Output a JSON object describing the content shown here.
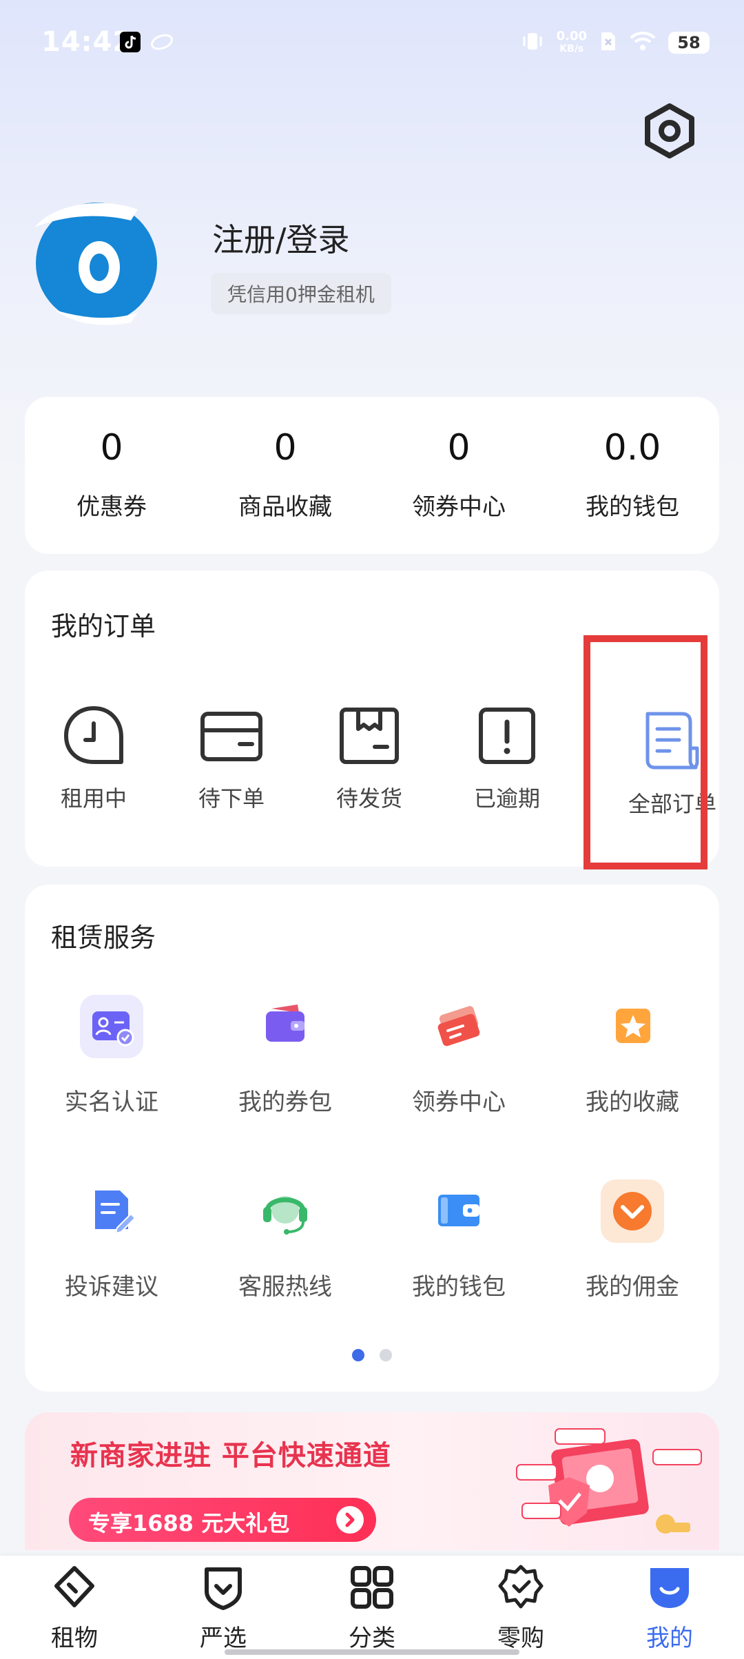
{
  "status": {
    "time": "14:42",
    "speed_value": "0.00",
    "speed_unit": "KB/s",
    "battery": "58"
  },
  "profile": {
    "login_title": "注册/登录",
    "subtitle": "凭信用0押金租机"
  },
  "stats": [
    {
      "value": "0",
      "label": "优惠券"
    },
    {
      "value": "0",
      "label": "商品收藏"
    },
    {
      "value": "0",
      "label": "领券中心"
    },
    {
      "value": "0.0",
      "label": "我的钱包"
    }
  ],
  "orders": {
    "title": "我的订单",
    "items": [
      {
        "label": "租用中",
        "icon": "clock-icon"
      },
      {
        "label": "待下单",
        "icon": "card-icon"
      },
      {
        "label": "待发货",
        "icon": "package-icon"
      },
      {
        "label": "已逾期",
        "icon": "alert-icon"
      },
      {
        "label": "全部订单",
        "icon": "document-icon"
      }
    ]
  },
  "services": {
    "title": "租赁服务",
    "items": [
      {
        "label": "实名认证",
        "icon": "id-card-icon",
        "color": "#6b63f6"
      },
      {
        "label": "我的券包",
        "icon": "wallet-icon",
        "color": "#7a5cf0"
      },
      {
        "label": "领券中心",
        "icon": "ticket-icon",
        "color": "#f0524a"
      },
      {
        "label": "我的收藏",
        "icon": "star-icon",
        "color": "#ffa53c"
      },
      {
        "label": "投诉建议",
        "icon": "edit-document-icon",
        "color": "#4d7ef5"
      },
      {
        "label": "客服热线",
        "icon": "headset-icon",
        "color": "#39b86a"
      },
      {
        "label": "我的钱包",
        "icon": "purse-icon",
        "color": "#3a8ef5"
      },
      {
        "label": "我的佣金",
        "icon": "commission-icon",
        "color": "#f77a2e"
      }
    ],
    "page_dots": 2,
    "active_dot": 0
  },
  "banner": {
    "title": "新商家进驻 平台快速通道",
    "button": "专享1688 元大礼包"
  },
  "tabbar": [
    {
      "label": "租物",
      "icon": "rent-icon",
      "active": false
    },
    {
      "label": "严选",
      "icon": "shield-check-icon",
      "active": false
    },
    {
      "label": "分类",
      "icon": "grid-icon",
      "active": false
    },
    {
      "label": "零购",
      "icon": "badge-check-icon",
      "active": false
    },
    {
      "label": "我的",
      "icon": "smile-icon",
      "active": true
    }
  ],
  "colors": {
    "accent": "#3b6cf0",
    "highlight": "#e53b3b",
    "banner_red": "#e8334f"
  }
}
